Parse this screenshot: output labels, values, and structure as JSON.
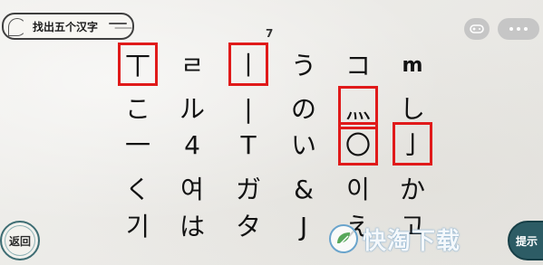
{
  "header": {
    "title": "找出五个汉字",
    "found_count": "7"
  },
  "toolbar": {
    "game_icon": "gamepad-icon",
    "more_icon": "more-dots-icon"
  },
  "grid": {
    "rows": [
      [
        "丅",
        "ㄹ",
        "丨",
        "う",
        "コ",
        "m"
      ],
      [
        "こ",
        "ル",
        "|",
        "の",
        "灬",
        "し"
      ],
      [
        "一",
        "4",
        "T",
        "い",
        "〇",
        "亅"
      ],
      [
        "く",
        "여",
        "ガ",
        "&",
        "이",
        "か"
      ],
      [
        "기",
        "は",
        "タ",
        "J",
        "え",
        "고"
      ]
    ],
    "highlighted": [
      {
        "row": 0,
        "col": 0
      },
      {
        "row": 0,
        "col": 2
      },
      {
        "row": 1,
        "col": 4
      },
      {
        "row": 2,
        "col": 4
      },
      {
        "row": 2,
        "col": 5
      }
    ]
  },
  "buttons": {
    "back_label": "返回",
    "hint_label": "提示"
  },
  "watermark": {
    "text": "快淘下载"
  },
  "colors": {
    "highlight": "#e01a1a",
    "hint_bg": "#2d5c65",
    "back_border": "#3e6d73"
  }
}
